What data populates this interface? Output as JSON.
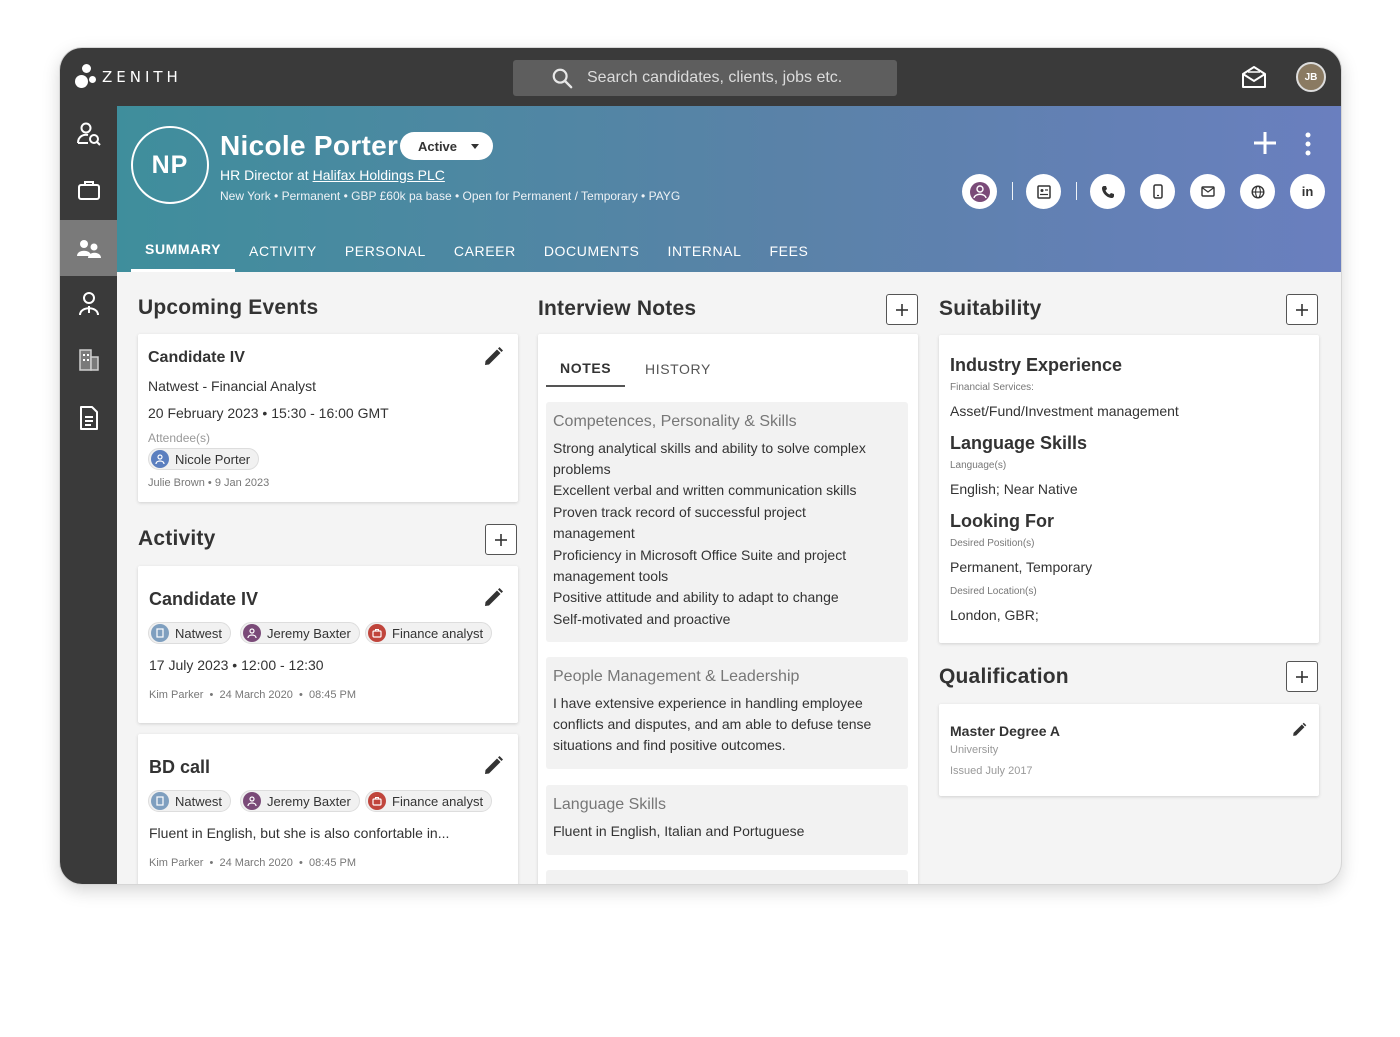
{
  "app": {
    "brand": "ZENITH",
    "user_initials": "JB"
  },
  "search": {
    "placeholder": "Search candidates, clients, jobs etc."
  },
  "candidate": {
    "initials": "NP",
    "name": "Nicole Porter",
    "status": "Active",
    "role_prefix": "HR Director at ",
    "company": "Halifax Holdings PLC",
    "meta": "New York • Permanent • GBP £60k pa base • Open for Permanent / Temporary • PAYG"
  },
  "header_icons": {
    "linkedin": "in"
  },
  "tabs": [
    "SUMMARY",
    "ACTIVITY",
    "PERSONAL",
    "CAREER",
    "DOCUMENTS",
    "INTERNAL",
    "FEES"
  ],
  "upcoming": {
    "title": "Upcoming Events",
    "event": {
      "title": "Candidate IV",
      "subtitle": "Natwest - Financial Analyst",
      "datetime": "20 February 2023 • 15:30 - 16:00 GMT",
      "attendees_label": "Attendee(s)",
      "attendee": "Nicole Porter",
      "footer": "Julie Brown • 9 Jan 2023"
    }
  },
  "activity": {
    "title": "Activity",
    "items": [
      {
        "title": "Candidate IV",
        "chips": [
          "Natwest",
          "Jeremy Baxter",
          "Finance analyst"
        ],
        "body": "17 July 2023 • 12:00 - 12:30",
        "author": "Kim Parker",
        "date": "24 March 2020",
        "time": "08:45 PM"
      },
      {
        "title": "BD call",
        "chips": [
          "Natwest",
          "Jeremy Baxter",
          "Finance analyst"
        ],
        "body": "Fluent in English, but she is also confortable in...",
        "author": "Kim Parker",
        "date": "24 March 2020",
        "time": "08:45 PM"
      }
    ]
  },
  "interview": {
    "title": "Interview Notes",
    "tabs": [
      "NOTES",
      "HISTORY"
    ],
    "blocks": [
      {
        "heading": "Competences, Personality  & Skills",
        "lines": [
          "Strong analytical skills and ability to solve complex",
          "problems",
          "Excellent verbal and written communication skills",
          "Proven track record of successful project",
          "management",
          "Proficiency in Microsoft Office Suite and project",
          "management tools",
          "Positive attitude and ability to adapt to change",
          "Self-motivated and proactive"
        ]
      },
      {
        "heading": "People Management & Leadership",
        "lines": [
          "I have extensive experience in handling employee",
          "conflicts and disputes, and am able to defuse tense",
          "situations and find positive outcomes."
        ]
      },
      {
        "heading": "Language Skills",
        "lines": [
          "Fluent in English, Italian and Portuguese"
        ]
      }
    ]
  },
  "suitability": {
    "title": "Suitability",
    "industry": {
      "title": "Industry Experience",
      "label": "Financial Services:",
      "value": "Asset/Fund/Investment management"
    },
    "language": {
      "title": "Language Skills",
      "label": "Language(s)",
      "value": "English; Near Native"
    },
    "looking": {
      "title": "Looking For",
      "pos_label": "Desired Position(s)",
      "pos_value": "Permanent, Temporary",
      "loc_label": "Desired Location(s)",
      "loc_value": "London, GBR;"
    }
  },
  "qualification": {
    "title": "Qualification",
    "item": {
      "title": "Master Degree A",
      "type": "University",
      "issued": "Issued July 2017"
    }
  }
}
